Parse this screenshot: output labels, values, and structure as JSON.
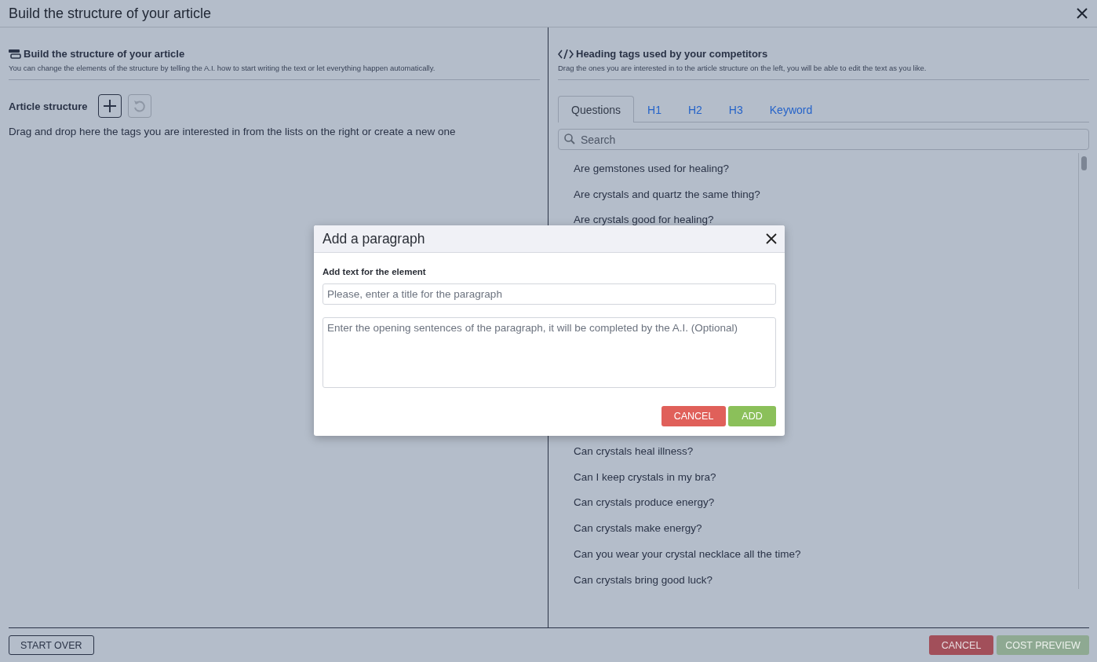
{
  "window": {
    "title": "Build the structure of your article"
  },
  "left": {
    "title": "Build the structure of your article",
    "subtitle": "You can change the elements of the structure by telling the A.I. how to start writing the text or let everything happen automatically.",
    "structure_label": "Article structure",
    "add_button": {
      "disabled": false
    },
    "undo_button": {
      "disabled": true
    },
    "empty_hint": "Drag and drop here the tags you are interested in from the lists on the right or create a new one"
  },
  "right": {
    "title": "Heading tags used by your competitors",
    "subtitle": "Drag the ones you are interested in to the article structure on the left, you will be able to edit the text as you like.",
    "tabs": [
      {
        "label": "Questions",
        "selected": true
      },
      {
        "label": "H1",
        "selected": false
      },
      {
        "label": "H2",
        "selected": false
      },
      {
        "label": "H3",
        "selected": false
      },
      {
        "label": "Keyword",
        "selected": false
      }
    ],
    "search": {
      "placeholder": "Search"
    },
    "items_above_dialog": [
      "Are gemstones used for healing?",
      "Are crystals and quartz the same thing?",
      "Are crystals good for healing?"
    ],
    "items_below_dialog": [
      "Can crystals heal illness?",
      "Can I keep crystals in my bra?",
      "Can crystals produce energy?",
      "Can crystals make energy?",
      "Can you wear your crystal necklace all the time?",
      "Can crystals bring good luck?"
    ]
  },
  "footer": {
    "start_over": "START OVER",
    "cancel": "CANCEL",
    "cost_preview": {
      "label": "COST PREVIEW",
      "disabled": true
    }
  },
  "dialog": {
    "title": "Add a paragraph",
    "label": "Add text for the element",
    "title_field": {
      "placeholder": "Please, enter a title for the paragraph"
    },
    "text_field": {
      "placeholder": "Enter the opening sentences of the paragraph, it will be completed by the A.I. (Optional)"
    },
    "cancel": "CANCEL",
    "add": "ADD"
  }
}
